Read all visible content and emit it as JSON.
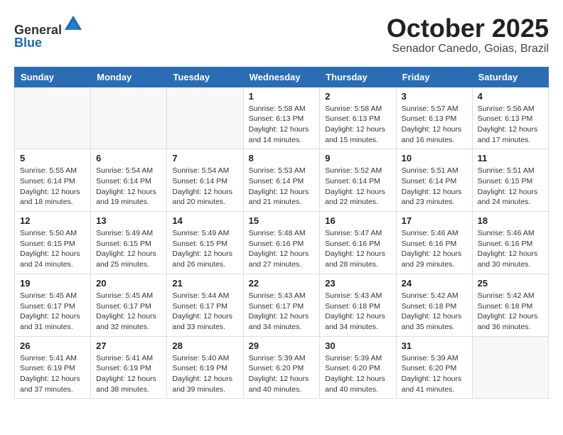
{
  "header": {
    "logo_line1": "General",
    "logo_line2": "Blue",
    "month_title": "October 2025",
    "subtitle": "Senador Canedo, Goias, Brazil"
  },
  "days_of_week": [
    "Sunday",
    "Monday",
    "Tuesday",
    "Wednesday",
    "Thursday",
    "Friday",
    "Saturday"
  ],
  "weeks": [
    [
      {
        "day": "",
        "info": ""
      },
      {
        "day": "",
        "info": ""
      },
      {
        "day": "",
        "info": ""
      },
      {
        "day": "1",
        "info": "Sunrise: 5:58 AM\nSunset: 6:13 PM\nDaylight: 12 hours\nand 14 minutes."
      },
      {
        "day": "2",
        "info": "Sunrise: 5:58 AM\nSunset: 6:13 PM\nDaylight: 12 hours\nand 15 minutes."
      },
      {
        "day": "3",
        "info": "Sunrise: 5:57 AM\nSunset: 6:13 PM\nDaylight: 12 hours\nand 16 minutes."
      },
      {
        "day": "4",
        "info": "Sunrise: 5:56 AM\nSunset: 6:13 PM\nDaylight: 12 hours\nand 17 minutes."
      }
    ],
    [
      {
        "day": "5",
        "info": "Sunrise: 5:55 AM\nSunset: 6:14 PM\nDaylight: 12 hours\nand 18 minutes."
      },
      {
        "day": "6",
        "info": "Sunrise: 5:54 AM\nSunset: 6:14 PM\nDaylight: 12 hours\nand 19 minutes."
      },
      {
        "day": "7",
        "info": "Sunrise: 5:54 AM\nSunset: 6:14 PM\nDaylight: 12 hours\nand 20 minutes."
      },
      {
        "day": "8",
        "info": "Sunrise: 5:53 AM\nSunset: 6:14 PM\nDaylight: 12 hours\nand 21 minutes."
      },
      {
        "day": "9",
        "info": "Sunrise: 5:52 AM\nSunset: 6:14 PM\nDaylight: 12 hours\nand 22 minutes."
      },
      {
        "day": "10",
        "info": "Sunrise: 5:51 AM\nSunset: 6:14 PM\nDaylight: 12 hours\nand 23 minutes."
      },
      {
        "day": "11",
        "info": "Sunrise: 5:51 AM\nSunset: 6:15 PM\nDaylight: 12 hours\nand 24 minutes."
      }
    ],
    [
      {
        "day": "12",
        "info": "Sunrise: 5:50 AM\nSunset: 6:15 PM\nDaylight: 12 hours\nand 24 minutes."
      },
      {
        "day": "13",
        "info": "Sunrise: 5:49 AM\nSunset: 6:15 PM\nDaylight: 12 hours\nand 25 minutes."
      },
      {
        "day": "14",
        "info": "Sunrise: 5:49 AM\nSunset: 6:15 PM\nDaylight: 12 hours\nand 26 minutes."
      },
      {
        "day": "15",
        "info": "Sunrise: 5:48 AM\nSunset: 6:16 PM\nDaylight: 12 hours\nand 27 minutes."
      },
      {
        "day": "16",
        "info": "Sunrise: 5:47 AM\nSunset: 6:16 PM\nDaylight: 12 hours\nand 28 minutes."
      },
      {
        "day": "17",
        "info": "Sunrise: 5:46 AM\nSunset: 6:16 PM\nDaylight: 12 hours\nand 29 minutes."
      },
      {
        "day": "18",
        "info": "Sunrise: 5:46 AM\nSunset: 6:16 PM\nDaylight: 12 hours\nand 30 minutes."
      }
    ],
    [
      {
        "day": "19",
        "info": "Sunrise: 5:45 AM\nSunset: 6:17 PM\nDaylight: 12 hours\nand 31 minutes."
      },
      {
        "day": "20",
        "info": "Sunrise: 5:45 AM\nSunset: 6:17 PM\nDaylight: 12 hours\nand 32 minutes."
      },
      {
        "day": "21",
        "info": "Sunrise: 5:44 AM\nSunset: 6:17 PM\nDaylight: 12 hours\nand 33 minutes."
      },
      {
        "day": "22",
        "info": "Sunrise: 5:43 AM\nSunset: 6:17 PM\nDaylight: 12 hours\nand 34 minutes."
      },
      {
        "day": "23",
        "info": "Sunrise: 5:43 AM\nSunset: 6:18 PM\nDaylight: 12 hours\nand 34 minutes."
      },
      {
        "day": "24",
        "info": "Sunrise: 5:42 AM\nSunset: 6:18 PM\nDaylight: 12 hours\nand 35 minutes."
      },
      {
        "day": "25",
        "info": "Sunrise: 5:42 AM\nSunset: 6:18 PM\nDaylight: 12 hours\nand 36 minutes."
      }
    ],
    [
      {
        "day": "26",
        "info": "Sunrise: 5:41 AM\nSunset: 6:19 PM\nDaylight: 12 hours\nand 37 minutes."
      },
      {
        "day": "27",
        "info": "Sunrise: 5:41 AM\nSunset: 6:19 PM\nDaylight: 12 hours\nand 38 minutes."
      },
      {
        "day": "28",
        "info": "Sunrise: 5:40 AM\nSunset: 6:19 PM\nDaylight: 12 hours\nand 39 minutes."
      },
      {
        "day": "29",
        "info": "Sunrise: 5:39 AM\nSunset: 6:20 PM\nDaylight: 12 hours\nand 40 minutes."
      },
      {
        "day": "30",
        "info": "Sunrise: 5:39 AM\nSunset: 6:20 PM\nDaylight: 12 hours\nand 40 minutes."
      },
      {
        "day": "31",
        "info": "Sunrise: 5:39 AM\nSunset: 6:20 PM\nDaylight: 12 hours\nand 41 minutes."
      },
      {
        "day": "",
        "info": ""
      }
    ]
  ]
}
